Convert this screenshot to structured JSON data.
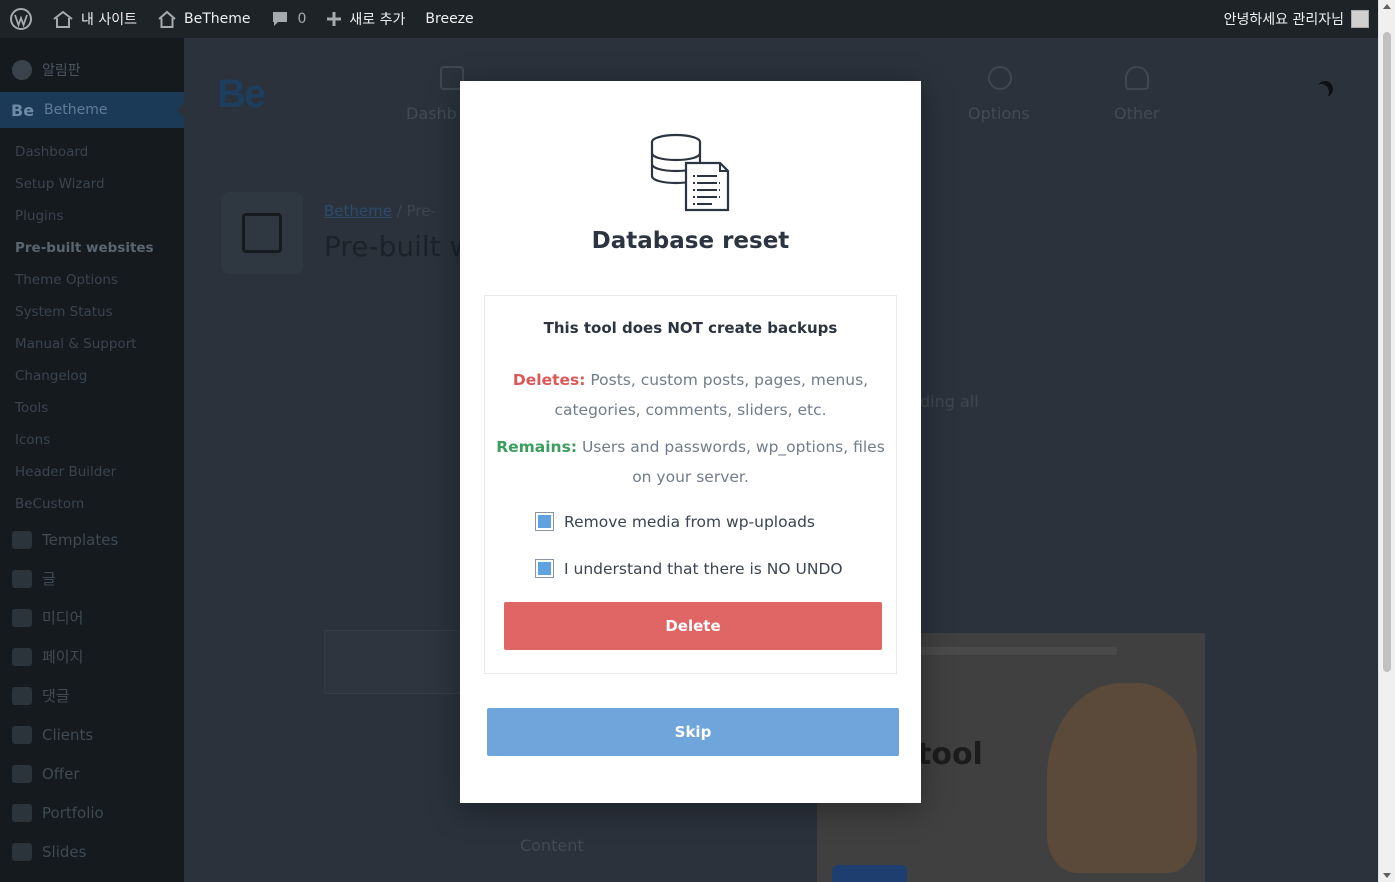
{
  "adminbar": {
    "site_name": "내 사이트",
    "betheme": "BeTheme",
    "comments_count": "0",
    "new_label": "새로 추가",
    "breeze": "Breeze",
    "greeting": "안녕하세요 관리자님"
  },
  "sidebar": {
    "dashboard": "알림판",
    "betheme": "Betheme",
    "be_logo": "Be",
    "submenu": [
      "Dashboard",
      "Setup Wizard",
      "Plugins",
      "Pre-built websites",
      "Theme Options",
      "System Status",
      "Manual & Support",
      "Changelog",
      "Tools",
      "Icons",
      "Header Builder",
      "BeCustom"
    ],
    "menu": [
      "Templates",
      "글",
      "미디어",
      "페이지",
      "댓글",
      "Clients",
      "Offer",
      "Portfolio",
      "Slides"
    ]
  },
  "background": {
    "logo": "Be",
    "nav": [
      "Dashb",
      "Options",
      "Other"
    ],
    "breadcrumb_link": "Betheme",
    "breadcrumb_sep": "/",
    "breadcrumb_current": "Pre-",
    "title": "Pre-built w",
    "text_fragment": "ding all",
    "content_label": "Content",
    "preview_tool": "tool"
  },
  "modal": {
    "title": "Database reset",
    "warning": "This tool does NOT create backups",
    "deletes_label": "Deletes:",
    "deletes_text": " Posts, custom posts, pages, menus, categories, comments, sliders, etc.",
    "remains_label": "Remains:",
    "remains_text": " Users and passwords, wp_options, files on your server.",
    "checkbox_media": "Remove media from wp-uploads",
    "checkbox_undo": "I understand that there is NO UNDO",
    "delete_button": "Delete",
    "skip_button": "Skip"
  }
}
